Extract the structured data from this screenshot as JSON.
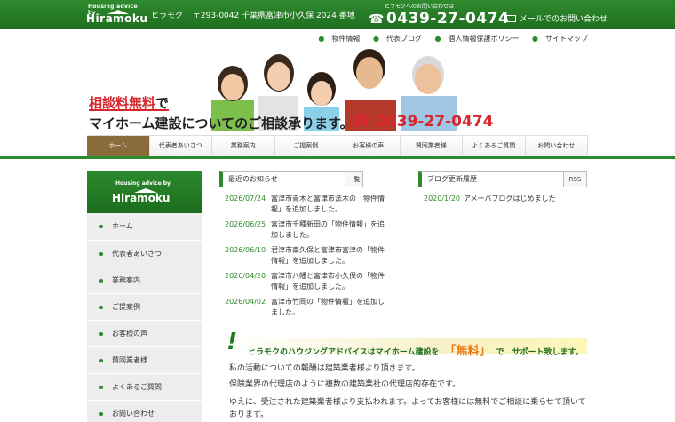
{
  "header": {
    "logo_small": "Housing advice   by",
    "logo_big": "Hiramoku",
    "company": "ヒラモク",
    "address": "〒293-0042 千葉県富津市小久保 2024 番地",
    "phone_caption": "ヒラモクへのお問い合わせは",
    "phone": "0439-27-0474",
    "mail_label": "メールでのお問い合わせ"
  },
  "subnav": [
    "物件情報",
    "代表ブログ",
    "個人情報保護ポリシー",
    "サイトマップ"
  ],
  "hero": {
    "line1": "相談料無料",
    "line1_suffix": "で",
    "line2": "マイホーム建設についてのご相談承ります。",
    "phone": "0439-27-0474"
  },
  "mainnav": [
    "ホーム",
    "代表者あいさつ",
    "業務案内",
    "ご提案例",
    "お客様の声",
    "賛同業者様",
    "よくあるご質問",
    "お問い合わせ"
  ],
  "sidebar": {
    "logo_small": "Housing advice   by",
    "logo_big": "Hiramoku",
    "items": [
      "ホーム",
      "代表者あいさつ",
      "業務案内",
      "ご提案例",
      "お客様の声",
      "賛同業者様",
      "よくあるご質問",
      "お問い合わせ"
    ]
  },
  "news": {
    "title": "最近のお知らせ",
    "more": "一覧",
    "items": [
      {
        "date": "2026/07/24",
        "text": "富津市青木と富津市法木の「物件情報」を追加しました。"
      },
      {
        "date": "2026/06/25",
        "text": "富津市千種新田の「物件情報」を追加しました。"
      },
      {
        "date": "2026/06/10",
        "text": "君津市南久保と富津市富津の「物件情報」を追加しました。"
      },
      {
        "date": "2026/04/20",
        "text": "富津市八幡と富津市小久保の「物件情報」を追加しました。"
      },
      {
        "date": "2026/04/02",
        "text": "富津市竹岡の「物件情報」を追加しました。"
      }
    ]
  },
  "blog": {
    "title": "ブログ更新履歴",
    "more": "RSS",
    "items": [
      {
        "date": "2020/1/20",
        "text": "アメーバブログはじめました"
      }
    ]
  },
  "banner": {
    "excl": "!",
    "text_before": "ヒラモクのハウジングアドバイスはマイホーム建設を",
    "free": "「無料」",
    "text_after": "で　サポート致します。"
  },
  "body": {
    "p1": "私の活動についての報酬は建築業者様より頂きます。",
    "p2": "保険業界の代理店のように複数の建築業社の代理店的存在です。",
    "p3": "ゆえに、受注された建築業者様より支払われます。よってお客様には無料でご相談に乗らせて頂いております。"
  }
}
